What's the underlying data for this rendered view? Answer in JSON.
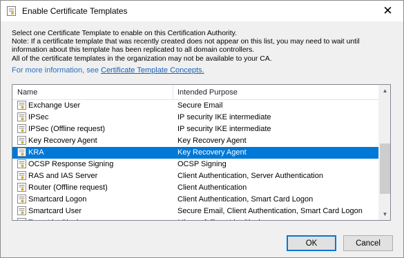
{
  "window": {
    "title": "Enable Certificate Templates",
    "close_glyph": "✕"
  },
  "description": {
    "line1": "Select one Certificate Template to enable on this Certification Authority.",
    "line2": "Note: If a certificate template that was recently created does not appear on this list, you may need to wait until",
    "line3": "information about this template has been replicated to all domain controllers.",
    "line4": "All of the certificate templates in the organization may not be available to your CA.",
    "more_info_prefix": "For more information, see ",
    "more_info_link": "Certificate Template Concepts."
  },
  "list": {
    "columns": {
      "name": "Name",
      "purpose": "Intended Purpose"
    },
    "rows": [
      {
        "name": "Exchange User",
        "purpose": "Secure Email"
      },
      {
        "name": "IPSec",
        "purpose": "IP security IKE intermediate"
      },
      {
        "name": "IPSec (Offline request)",
        "purpose": "IP security IKE intermediate"
      },
      {
        "name": "Key Recovery Agent",
        "purpose": "Key Recovery Agent"
      },
      {
        "name": "KRA",
        "purpose": "Key Recovery Agent",
        "selected": true
      },
      {
        "name": "OCSP Response Signing",
        "purpose": "OCSP Signing"
      },
      {
        "name": "RAS and IAS Server",
        "purpose": "Client Authentication, Server Authentication"
      },
      {
        "name": "Router (Offline request)",
        "purpose": "Client Authentication"
      },
      {
        "name": "Smartcard Logon",
        "purpose": "Client Authentication, Smart Card Logon"
      },
      {
        "name": "Smartcard User",
        "purpose": "Secure Email, Client Authentication, Smart Card Logon"
      },
      {
        "name": "Trust List Signing",
        "purpose": "Microsoft Trust List Signing"
      }
    ]
  },
  "buttons": {
    "ok": "OK",
    "cancel": "Cancel"
  },
  "colors": {
    "selection": "#0078d7",
    "link": "#1a5fb4"
  },
  "icons": {
    "row_icon": "certificate-template-icon",
    "scroll_up": "▲",
    "scroll_down": "▼"
  }
}
